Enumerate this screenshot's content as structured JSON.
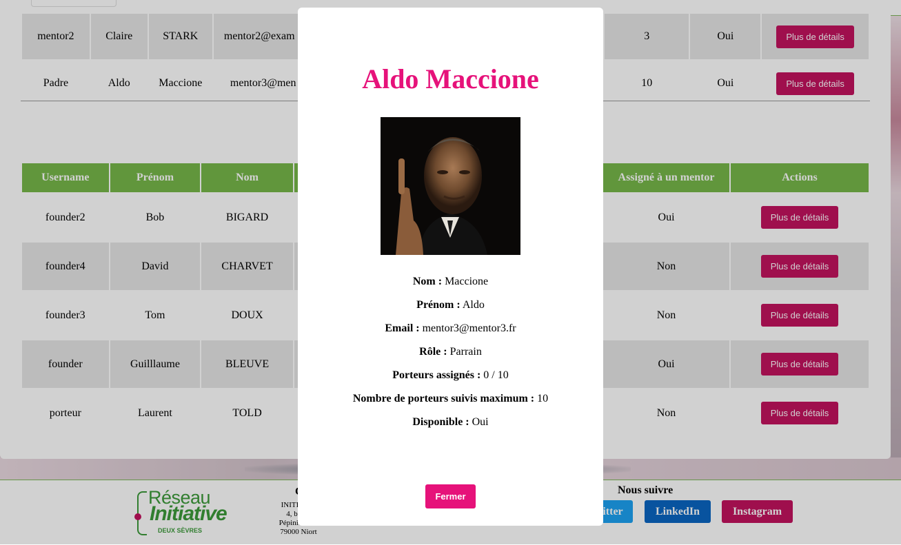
{
  "mentors": [
    {
      "username": "mentor2",
      "prenom": "Claire",
      "nom": "STARK",
      "email": "mentor2@exam",
      "max": "3",
      "dispo": "Oui",
      "action": "Plus de détails"
    },
    {
      "username": "Padre",
      "prenom": "Aldo",
      "nom": "Maccione",
      "email": "mentor3@men",
      "max": "10",
      "dispo": "Oui",
      "action": "Plus de détails"
    }
  ],
  "porteurs": {
    "headers": {
      "username": "Username",
      "prenom": "Prénom",
      "nom": "Nom",
      "assigne": "Assigné à un mentor",
      "actions": "Actions"
    },
    "rows": [
      {
        "username": "founder2",
        "prenom": "Bob",
        "nom": "BIGARD",
        "assigne": "Oui",
        "action": "Plus de détails"
      },
      {
        "username": "founder4",
        "prenom": "David",
        "nom": "CHARVET",
        "assigne": "Non",
        "action": "Plus de détails"
      },
      {
        "username": "founder3",
        "prenom": "Tom",
        "nom": "DOUX",
        "assigne": "Non",
        "action": "Plus de détails"
      },
      {
        "username": "founder",
        "prenom": "Guilllaume",
        "nom": "BLEUVE",
        "assigne": "Oui",
        "action": "Plus de détails"
      },
      {
        "username": "porteur",
        "prenom": "Laurent",
        "nom": "TOLD",
        "assigne": "Non",
        "action": "Plus de détails"
      }
    ]
  },
  "footer": {
    "logo": {
      "line1": "Réseau",
      "line2": "Initiative",
      "line3": "DEUX SÈVRES"
    },
    "contact_title": "C",
    "address": [
      "INITIATIV",
      "4, boule",
      "Pépinière d'e",
      "79000 Niort"
    ],
    "follow_title": "Nous suivre",
    "social": {
      "twitter": "itter",
      "linkedin": "LinkedIn",
      "instagram": "Instagram"
    }
  },
  "modal": {
    "title": "Aldo Maccione",
    "fields": [
      {
        "label": "Nom :",
        "value": "Maccione"
      },
      {
        "label": "Prénom :",
        "value": "Aldo"
      },
      {
        "label": "Email :",
        "value": "mentor3@mentor3.fr"
      },
      {
        "label": "Rôle :",
        "value": "Parrain"
      },
      {
        "label": "Porteurs assignés :",
        "value": "0 / 10"
      },
      {
        "label": "Nombre de porteurs suivis maximum :",
        "value": "10"
      },
      {
        "label": "Disponible :",
        "value": "Oui"
      }
    ],
    "close_label": "Fermer"
  },
  "colors": {
    "accent": "#c2135f",
    "title_pink": "#e6127a",
    "header_green": "#77b84a"
  }
}
